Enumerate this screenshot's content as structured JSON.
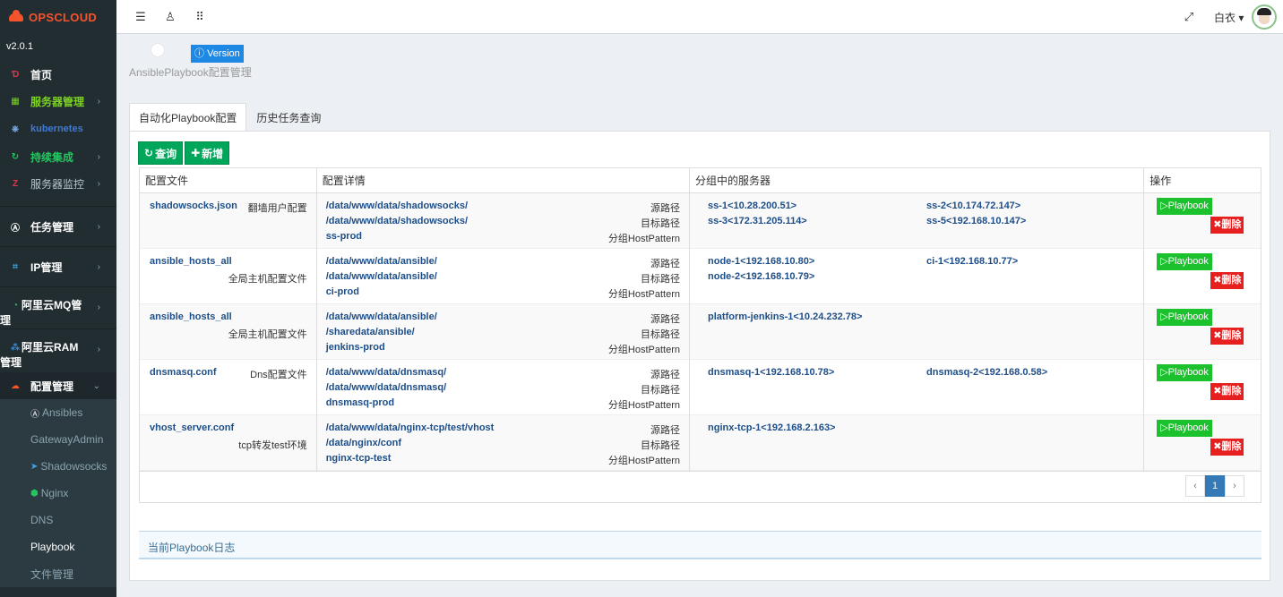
{
  "brand": {
    "name": "OPSCLOUD",
    "version": "v2.0.1"
  },
  "sidebar": {
    "items": [
      {
        "label": "首页",
        "icon": "dashboard-icon",
        "color": "#e8334a"
      },
      {
        "label": "服务器管理",
        "icon": "windows-icon",
        "color": "#7dd321"
      },
      {
        "label": "kubernetes",
        "icon": "helm-icon",
        "color": "#3e7ad6"
      },
      {
        "label": "持续集成",
        "icon": "ci-icon",
        "color": "#22c55e"
      },
      {
        "label": "服务器监控",
        "icon": "monitor-icon",
        "color": "#e8334a"
      },
      {
        "label": "任务管理",
        "icon": "ansible-icon",
        "color": "#ffffff"
      },
      {
        "label": "IP管理",
        "icon": "sitemap-icon",
        "color": "#32a0d8"
      },
      {
        "label": "阿里云MQ管理",
        "icon": "whatsapp-icon",
        "color": "#22c55e"
      },
      {
        "label": "阿里云RAM管理",
        "icon": "ram-icon",
        "color": "#3e8ed6"
      },
      {
        "label": "配置管理",
        "icon": "soundcloud-icon",
        "color": "#f5532b"
      }
    ],
    "submenu": [
      {
        "label": "Ansibles",
        "icon": "ansible-icon"
      },
      {
        "label": "GatewayAdmin",
        "icon": ""
      },
      {
        "label": "Shadowsocks",
        "icon": "paper-plane-icon"
      },
      {
        "label": "Nginx",
        "icon": "nginx-icon"
      },
      {
        "label": "DNS",
        "icon": ""
      },
      {
        "label": "Playbook",
        "icon": ""
      },
      {
        "label": "文件管理",
        "icon": ""
      }
    ]
  },
  "topbar": {
    "user": "白衣"
  },
  "header": {
    "version_badge": "Version",
    "subtitle": "AnsiblePlaybook配置管理"
  },
  "tabs": [
    "自动化Playbook配置",
    "历史任务查询"
  ],
  "buttons": {
    "query": "查询",
    "add": "新增",
    "playbook": "Playbook",
    "delete": "删除"
  },
  "table": {
    "headers": [
      "配置文件",
      "配置详情",
      "分组中的服务器",
      "操作"
    ],
    "path_labels": [
      "源路径",
      "目标路径",
      "分组HostPattern"
    ],
    "rows": [
      {
        "file": "shadowsocks.json",
        "desc": "翻墙用户配置",
        "paths": [
          "/data/www/data/shadowsocks/",
          "/data/www/data/shadowsocks/",
          "ss-prod"
        ],
        "servers": [
          "ss-1<10.28.200.51>",
          "ss-2<10.174.72.147>",
          "ss-3<172.31.205.114>",
          "ss-5<192.168.10.147>"
        ]
      },
      {
        "file": "ansible_hosts_all",
        "desc": "全局主机配置文件",
        "paths": [
          "/data/www/data/ansible/",
          "/data/www/data/ansible/",
          "ci-prod"
        ],
        "servers": [
          "node-1<192.168.10.80>",
          "ci-1<192.168.10.77>",
          "node-2<192.168.10.79>"
        ]
      },
      {
        "file": "ansible_hosts_all",
        "desc": "全局主机配置文件",
        "paths": [
          "/data/www/data/ansible/",
          "/sharedata/ansible/",
          "jenkins-prod"
        ],
        "servers": [
          "platform-jenkins-1<10.24.232.78>"
        ]
      },
      {
        "file": "dnsmasq.conf",
        "desc": "Dns配置文件",
        "paths": [
          "/data/www/data/dnsmasq/",
          "/data/www/data/dnsmasq/",
          "dnsmasq-prod"
        ],
        "servers": [
          "dnsmasq-1<192.168.10.78>",
          "dnsmasq-2<192.168.0.58>"
        ]
      },
      {
        "file": "vhost_server.conf",
        "desc": "tcp转发test环境",
        "paths": [
          "/data/www/data/nginx-tcp/test/vhost",
          "/data/nginx/conf",
          "nginx-tcp-test"
        ],
        "servers": [
          "nginx-tcp-1<192.168.2.163>"
        ]
      }
    ]
  },
  "pagination": {
    "prev": "‹",
    "current": "1",
    "next": "›"
  },
  "log": {
    "title": "当前Playbook日志"
  }
}
